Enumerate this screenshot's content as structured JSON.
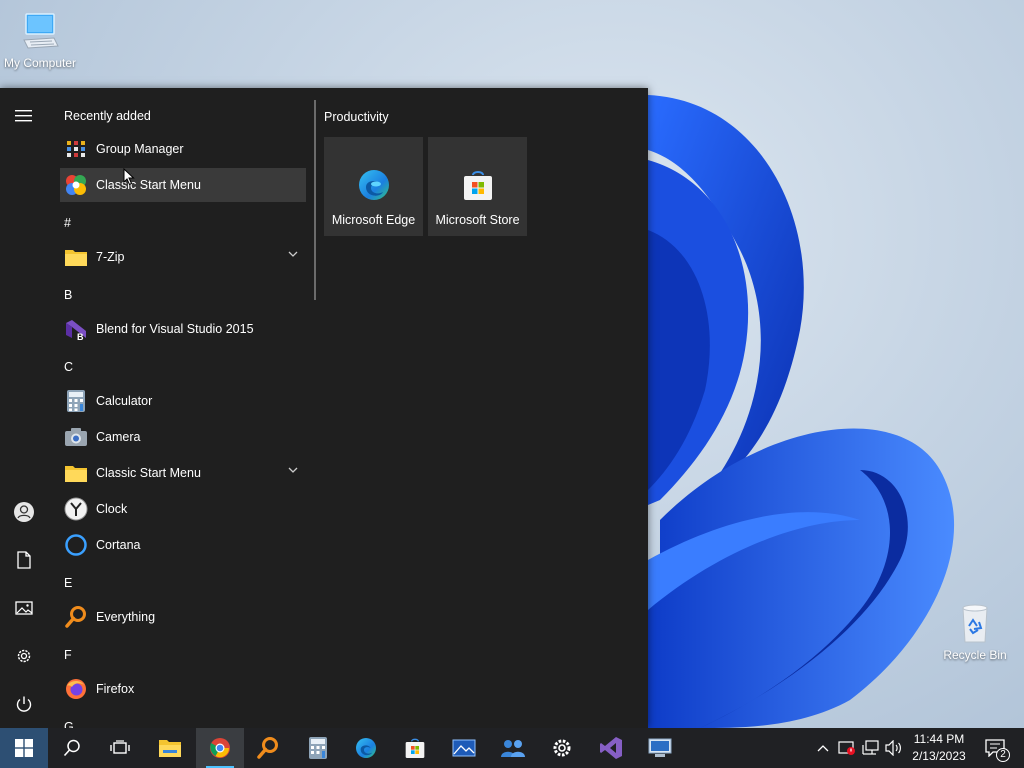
{
  "desktop": {
    "icons": [
      {
        "label": "My Computer",
        "icon": "computer-icon"
      },
      {
        "label": "Recycle Bin",
        "icon": "recycle-bin-icon"
      }
    ]
  },
  "start_menu": {
    "rail": [
      {
        "name": "menu-icon"
      },
      {
        "name": "user-icon"
      },
      {
        "name": "documents-icon"
      },
      {
        "name": "pictures-icon"
      },
      {
        "name": "settings-icon"
      },
      {
        "name": "power-icon"
      }
    ],
    "recently_added_header": "Recently added",
    "apps": [
      {
        "label": "Group Manager",
        "icon": "group-manager-icon"
      },
      {
        "label": "Classic Start Menu",
        "icon": "classic-start-menu-icon"
      },
      {
        "label": "7-Zip",
        "icon": "folder-icon"
      },
      {
        "label": "Blend for Visual Studio 2015",
        "icon": "blend-icon"
      },
      {
        "label": "Calculator",
        "icon": "calculator-icon"
      },
      {
        "label": "Camera",
        "icon": "camera-icon"
      },
      {
        "label": "Classic Start Menu",
        "icon": "folder-icon"
      },
      {
        "label": "Clock",
        "icon": "clock-icon"
      },
      {
        "label": "Cortana",
        "icon": "cortana-icon"
      },
      {
        "label": "Everything",
        "icon": "everything-icon"
      },
      {
        "label": "Firefox",
        "icon": "firefox-icon"
      }
    ],
    "letters": [
      "#",
      "B",
      "C",
      "E",
      "F",
      "G"
    ],
    "tiles_group": "Productivity",
    "tiles": [
      {
        "label": "Microsoft Edge",
        "icon": "edge-icon"
      },
      {
        "label": "Microsoft Store",
        "icon": "store-icon"
      }
    ]
  },
  "taskbar": {
    "apps": [
      "start-icon",
      "search-icon",
      "task-view-icon",
      "file-explorer-icon",
      "chrome-icon",
      "everything-icon",
      "calculator-icon",
      "edge-icon",
      "store-icon",
      "photos-icon",
      "people-icon",
      "settings-icon",
      "visual-studio-icon",
      "remote-desktop-icon"
    ],
    "time": "11:44 PM",
    "date": "2/13/2023",
    "notification_count": "2"
  },
  "colors": {
    "accent": "#4cc2ff",
    "menu_bg": "#1f1f1f",
    "taskbar_bg": "#202124",
    "tile_bg": "#333333"
  }
}
